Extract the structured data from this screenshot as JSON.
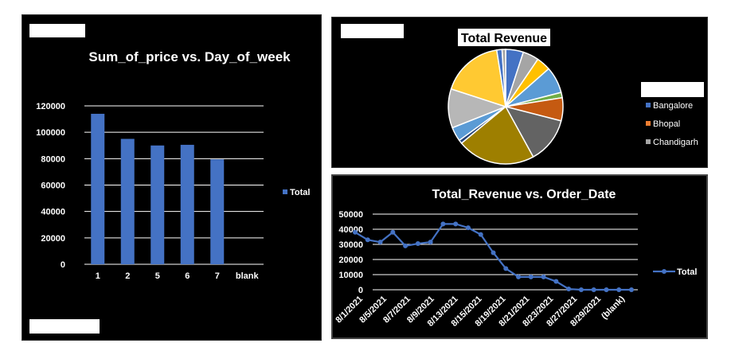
{
  "colors": {
    "panel_bg": "#000000",
    "series": "#4472c4",
    "grid": "#ffffff",
    "text": "#ffffff"
  },
  "chart_data": [
    {
      "type": "bar",
      "title": "Sum_of_price vs. Day_of_week",
      "categories": [
        "1",
        "2",
        "5",
        "6",
        "7",
        "blank"
      ],
      "series": [
        {
          "name": "Total",
          "values": [
            114000,
            95000,
            90000,
            90500,
            79500,
            null
          ]
        }
      ],
      "ylim": [
        0,
        120000
      ],
      "yticks": [
        "0",
        "20000",
        "40000",
        "60000",
        "80000",
        "100000",
        "120000"
      ],
      "grid": true,
      "legend_position": "right"
    },
    {
      "type": "pie",
      "title": "Total Revenue",
      "legend": [
        "Bangalore",
        "Bhopal",
        "Chandigarh"
      ],
      "legend_position": "right",
      "slices": [
        {
          "value": 5.0,
          "color": "#4472c4"
        },
        {
          "value": 4.5,
          "color": "#a5a5a5"
        },
        {
          "value": 4.0,
          "color": "#ffc000"
        },
        {
          "value": 7.5,
          "color": "#5b9bd5"
        },
        {
          "value": 1.5,
          "color": "#70ad47"
        },
        {
          "value": 6.5,
          "color": "#c55a11"
        },
        {
          "value": 13.0,
          "color": "#636363"
        },
        {
          "value": 22.0,
          "color": "#9e7f00"
        },
        {
          "value": 1.0,
          "color": "#264478"
        },
        {
          "value": 4.0,
          "color": "#5b9bd5"
        },
        {
          "value": 11.0,
          "color": "#b7b7b7"
        },
        {
          "value": 17.5,
          "color": "#ffc932"
        },
        {
          "value": 1.5,
          "color": "#4472c4"
        },
        {
          "value": 1.0,
          "color": "#a5a5a5"
        }
      ]
    },
    {
      "type": "line",
      "title": "Total_Revenue vs. Order_Date",
      "xticks": [
        "8/1/2021",
        "8/5/2021",
        "8/7/2021",
        "8/9/2021",
        "8/13/2021",
        "8/15/2021",
        "8/19/2021",
        "8/21/2021",
        "8/23/2021",
        "8/27/2021",
        "8/29/2021",
        "(blank)"
      ],
      "series": [
        {
          "name": "Total",
          "values": [
            38000,
            33000,
            31500,
            38000,
            29000,
            30500,
            31500,
            43500,
            43500,
            41000,
            36500,
            24500,
            14000,
            8500,
            8500,
            8500,
            5500,
            500,
            0,
            0,
            0,
            0,
            0
          ]
        }
      ],
      "ylim": [
        0,
        50000
      ],
      "yticks": [
        "0",
        "10000",
        "20000",
        "30000",
        "40000",
        "50000"
      ],
      "grid": true,
      "legend_position": "right"
    }
  ]
}
